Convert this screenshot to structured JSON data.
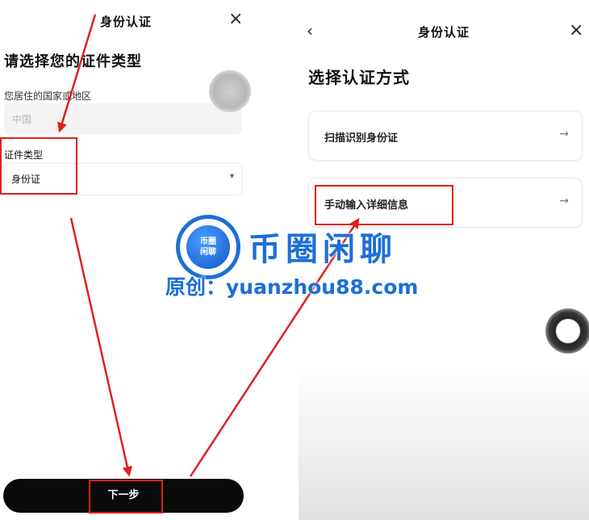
{
  "left_screen": {
    "title": "身份认证",
    "close_glyph": "×",
    "heading": "请选择您的证件类型",
    "country_label": "您居住的国家或地区",
    "country_placeholder": "中国",
    "doc_type_label": "证件类型",
    "doc_type_value": "身份证",
    "dropdown_glyph": "▾",
    "next_button": "下一步"
  },
  "right_screen": {
    "back_glyph": "‹",
    "title": "身份认证",
    "close_glyph": "×",
    "heading": "选择认证方式",
    "options": [
      {
        "label": "扫描识别身份证",
        "arrow": "→"
      },
      {
        "label": "手动输入详细信息",
        "arrow": "→"
      }
    ]
  },
  "watermark": {
    "logo_text_line1": "币圈",
    "logo_text_line2": "闲聊",
    "title": "币圈闲聊",
    "subtitle": "原创：yuanzhou88.com"
  },
  "colors": {
    "highlight": "#e02020",
    "watermark_blue": "#1c6fd6",
    "button_bg": "#0a0a0a"
  }
}
